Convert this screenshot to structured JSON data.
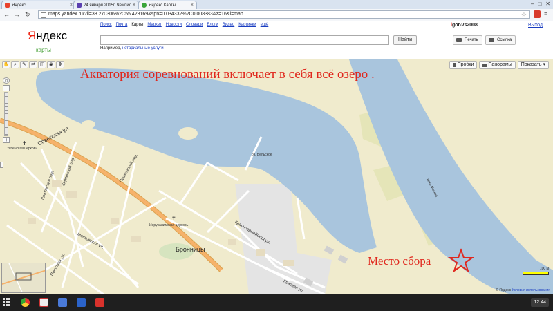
{
  "browser": {
    "tabs": [
      {
        "title": "Яндекс",
        "favicon_color": "#e8412c",
        "active": false
      },
      {
        "title": "24 января 2015г. Чемпион",
        "favicon_color": "#5a3fb0",
        "active": false
      },
      {
        "title": "Яндекс.Карты",
        "favicon_color": "#3aa53a",
        "active": true
      }
    ],
    "url": "maps.yandex.ru/?ll=38.270306%2C55.428169&spn=0.034332%2C0.008383&z=16&l=map"
  },
  "yandex_header": {
    "logo_first": "Я",
    "logo_rest": "ндекс",
    "logo_sub": "карты",
    "services": [
      "Поиск",
      "Почта",
      "Карты",
      "Маркет",
      "Новости",
      "Словари",
      "Блоги",
      "Видео",
      "Картинки",
      "ещё"
    ],
    "current_service": "Карты",
    "search_value": "",
    "find_button": "Найти",
    "example_prefix": "Например,",
    "example_link": "нотариальные услуги",
    "user_first": "i",
    "user_rest": "gor-vs2008",
    "exit_link": "Выход",
    "print_button": "Печать",
    "link_button": "Ссылка"
  },
  "map": {
    "layer_buttons": [
      "Пробки",
      "Панорамы",
      "Показать"
    ],
    "annotation_title": "Акватория соревнований включает в себя всё озеро .",
    "annotation_meeting": "Место сбора",
    "town_label": "Бронницы",
    "street_labels": [
      "Советская ул.",
      "Московская ул.",
      "Красноармейская ул.",
      "Пушкинский пер.",
      "Почтовая ул.",
      "Кирпичный пер.",
      "Шиловский пер.",
      "Красная ул."
    ],
    "poi_labels": [
      "Успенская церковь",
      "Иерусалимская церковь",
      "оз. Бельское",
      "река Москва"
    ],
    "scale_label": "100 м",
    "copyright": "© Яндекс",
    "terms_link": "Условия использования",
    "colors": {
      "land": "#f0ebcd",
      "water": "#a9c5dd",
      "road_main": "#f6b26b",
      "road": "#ffffff",
      "annotation": "#e0281e"
    }
  },
  "taskbar": {
    "clock": "12:44"
  }
}
